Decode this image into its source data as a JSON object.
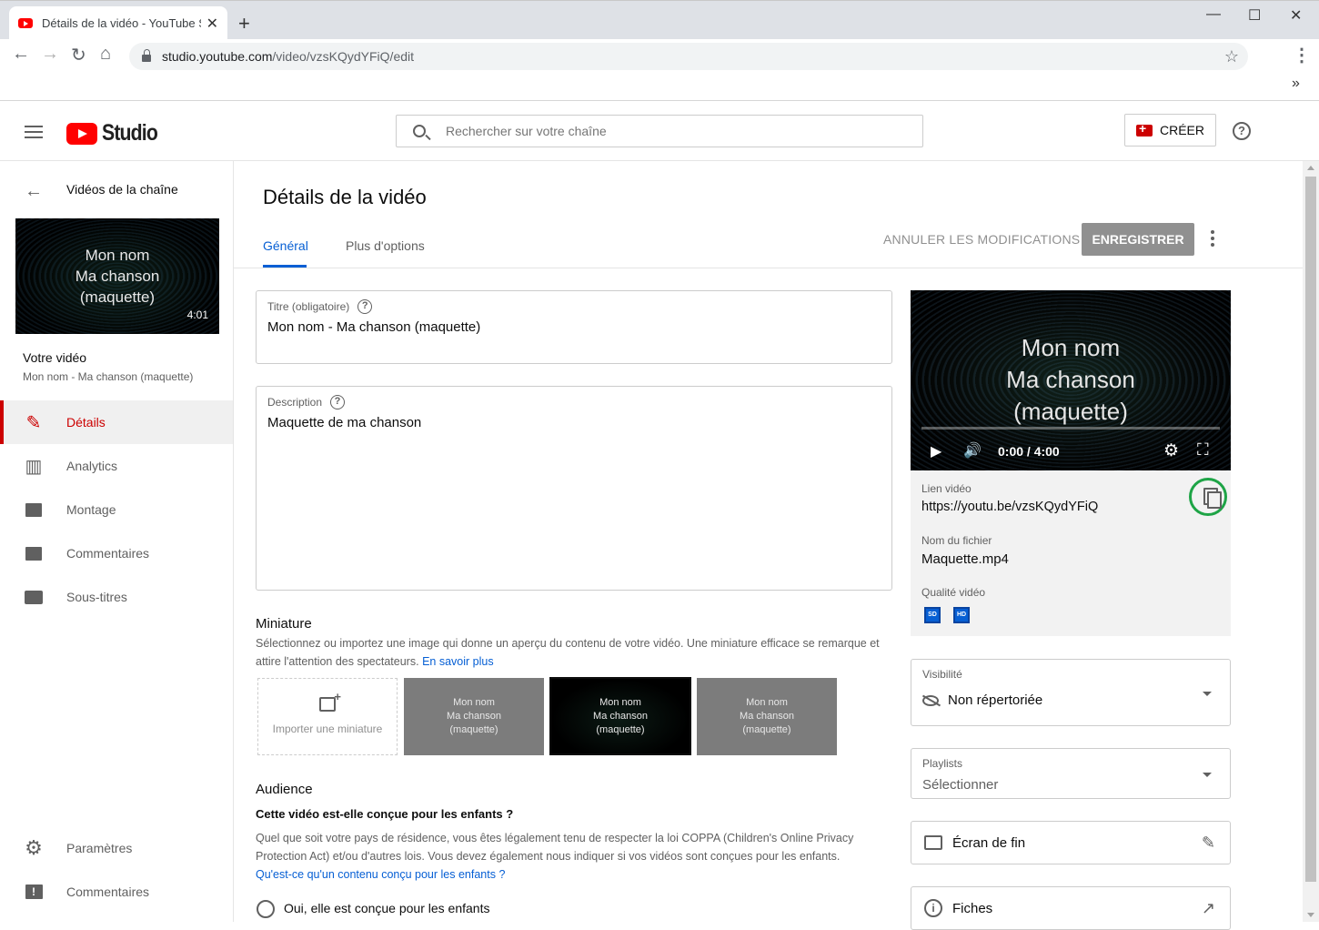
{
  "browser": {
    "tab_title": "Détails de la vidéo - YouTube Studio",
    "close_glyph": "✕",
    "new_tab_glyph": "+",
    "url_host": "studio.youtube.com",
    "url_path": "/video/vzsKQydYFiQ/edit",
    "star_glyph": "☆",
    "menu_glyph": "⋮",
    "overflow_glyph": "»",
    "back_glyph": "←",
    "forward_glyph": "→",
    "reload_glyph": "↻",
    "home_glyph": "⌂",
    "minimize_glyph": "—",
    "maximize_glyph": "☐",
    "winclose_glyph": "✕"
  },
  "header": {
    "logo_text": "Studio",
    "search_placeholder": "Rechercher sur votre chaîne",
    "create_label": "CRÉER",
    "help_glyph": "?"
  },
  "sidebar": {
    "back_label": "Vidéos de la chaîne",
    "back_glyph": "←",
    "thumbnail": {
      "lines": [
        "Mon nom",
        "Ma chanson",
        "(maquette)"
      ],
      "duration": "4:01"
    },
    "your_video_label": "Votre vidéo",
    "your_video_title": "Mon nom - Ma chanson (maquette)",
    "items": [
      {
        "label": "Détails",
        "icon": "pencil-icon",
        "glyph": "✎",
        "active": true
      },
      {
        "label": "Analytics",
        "icon": "analytics-icon",
        "glyph": "▥",
        "active": false
      },
      {
        "label": "Montage",
        "icon": "clapperboard-icon",
        "glyph": "🎬",
        "active": false
      },
      {
        "label": "Commentaires",
        "icon": "comment-icon",
        "glyph": "▤",
        "active": false
      },
      {
        "label": "Sous-titres",
        "icon": "subtitles-icon",
        "glyph": "▭",
        "active": false
      }
    ],
    "bottom_items": [
      {
        "label": "Paramètres",
        "icon": "gear-icon",
        "glyph": "⚙"
      },
      {
        "label": "Commentaires",
        "icon": "feedback-icon",
        "glyph": "!"
      }
    ]
  },
  "main": {
    "title": "Détails de la vidéo",
    "tabs": [
      {
        "label": "Général",
        "active": true
      },
      {
        "label": "Plus d'options",
        "active": false
      }
    ],
    "undo_label": "ANNULER LES MODIFICATIONS",
    "save_label": "ENREGISTRER",
    "title_field": {
      "label": "Titre (obligatoire)",
      "value": "Mon nom - Ma chanson (maquette)"
    },
    "description_field": {
      "label": "Description",
      "value": "Maquette de ma chanson"
    },
    "help_glyph": "?",
    "thumbnail_section": {
      "heading": "Miniature",
      "desc": "Sélectionnez ou importez une image qui donne un aperçu du contenu de votre vidéo. Une miniature efficace se remarque et attire l'attention des spectateurs.",
      "link": "En savoir plus",
      "upload_label": "Importer une miniature",
      "options": [
        {
          "lines": [
            "Mon nom",
            "Ma chanson",
            "(maquette)"
          ],
          "selected": false
        },
        {
          "lines": [
            "Mon nom",
            "Ma chanson",
            "(maquette)"
          ],
          "selected": true
        },
        {
          "lines": [
            "Mon nom",
            "Ma chanson",
            "(maquette)"
          ],
          "selected": false
        }
      ]
    },
    "audience": {
      "heading": "Audience",
      "question": "Cette vidéo est-elle conçue pour les enfants ?",
      "desc": "Quel que soit votre pays de résidence, vous êtes légalement tenu de respecter la loi COPPA (Children's Online Privacy Protection Act) et/ou d'autres lois. Vous devez également nous indiquer si vos vidéos sont conçues pour les enfants.",
      "link": "Qu'est-ce qu'un contenu conçu pour les enfants ?",
      "option_yes": "Oui, elle est conçue pour les enfants"
    }
  },
  "right": {
    "player": {
      "lines": [
        "Mon nom",
        "Ma chanson",
        "(maquette)"
      ],
      "time": "0:00 / 4:00",
      "progress": 0,
      "play_glyph": "▶",
      "volume_glyph": "🔊",
      "settings_glyph": "⚙",
      "fullscreen_glyph": "⛶"
    },
    "link_label": "Lien vidéo",
    "link_url": "https://youtu.be/vzsKQydYFiQ",
    "file_label": "Nom du fichier",
    "file_name": "Maquette.mp4",
    "quality_label": "Qualité vidéo",
    "quality_badges": [
      "SD",
      "HD"
    ],
    "visibility": {
      "label": "Visibilité",
      "value": "Non répertoriée"
    },
    "playlists": {
      "label": "Playlists",
      "value": "Sélectionner"
    },
    "end_screen": "Écran de fin",
    "end_screen_glyph": "✎",
    "cards": "Fiches",
    "cards_glyph": "↗",
    "info_glyph": "i",
    "accent_color": "#065fd4",
    "highlight_color": "#1ea446"
  }
}
